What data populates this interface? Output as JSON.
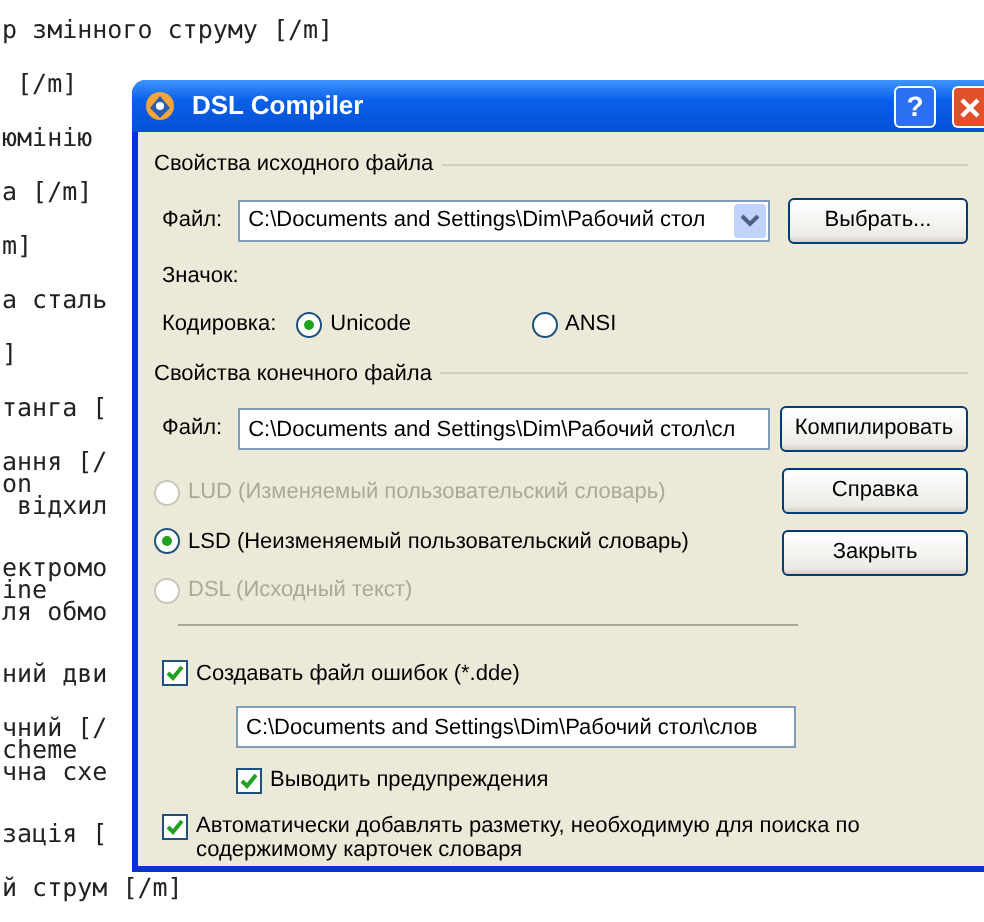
{
  "background_lines": [
    {
      "text": "р змінного струму [/m]"
    },
    {
      "text": " [/m]"
    },
    {
      "text": "юмінію"
    },
    {
      "text": "а [/m]"
    },
    {
      "text": "m]"
    },
    {
      "text": "а сталь"
    },
    {
      "text": "]"
    },
    {
      "text": "танга ["
    },
    {
      "text": "ання [/\non\n відхил"
    },
    {
      "text": "ектромо\nine\nля обмо"
    },
    {
      "text": "ний дви"
    },
    {
      "text": "чний [/\ncheme\nчна схе"
    },
    {
      "text": "зація ["
    },
    {
      "text": "й струм [/m]"
    }
  ],
  "window": {
    "title": "DSL Compiler",
    "help": "?",
    "source": {
      "heading": "Свойства исходного файла",
      "file_label": "Файл:",
      "file_value": "C:\\Documents and Settings\\Dim\\Рабочий стол",
      "browse_button": "Выбрать...",
      "icon_label": "Значок:",
      "encoding_label": "Кодировка:",
      "encodings": [
        {
          "label": "Unicode",
          "selected": true
        },
        {
          "label": "ANSI",
          "selected": false
        }
      ]
    },
    "target": {
      "heading": "Свойства конечного файла",
      "file_label": "Файл:",
      "file_value": "C:\\Documents and Settings\\Dim\\Рабочий стол\\сл",
      "compile_button": "Компилировать",
      "formats": [
        {
          "label": "LUD (Изменяемый пользовательский словарь)",
          "selected": false,
          "disabled": true
        },
        {
          "label": "LSD (Неизменяемый пользовательский словарь)",
          "selected": true,
          "disabled": false
        },
        {
          "label": "DSL (Исходный текст)",
          "selected": false,
          "disabled": true
        }
      ],
      "buttons": [
        "Справка",
        "Закрыть"
      ]
    },
    "error_file": {
      "label": "Создавать файл ошибок (*.dde)",
      "checked": true,
      "value": "C:\\Documents and Settings\\Dim\\Рабочий стол\\слов"
    },
    "warnings": {
      "label": "Выводить предупреждения",
      "checked": true
    },
    "auto_markup": {
      "label": "Автоматически добавлять разметку, необходимую для поиска по содержимому карточек словаря",
      "checked": true
    }
  }
}
